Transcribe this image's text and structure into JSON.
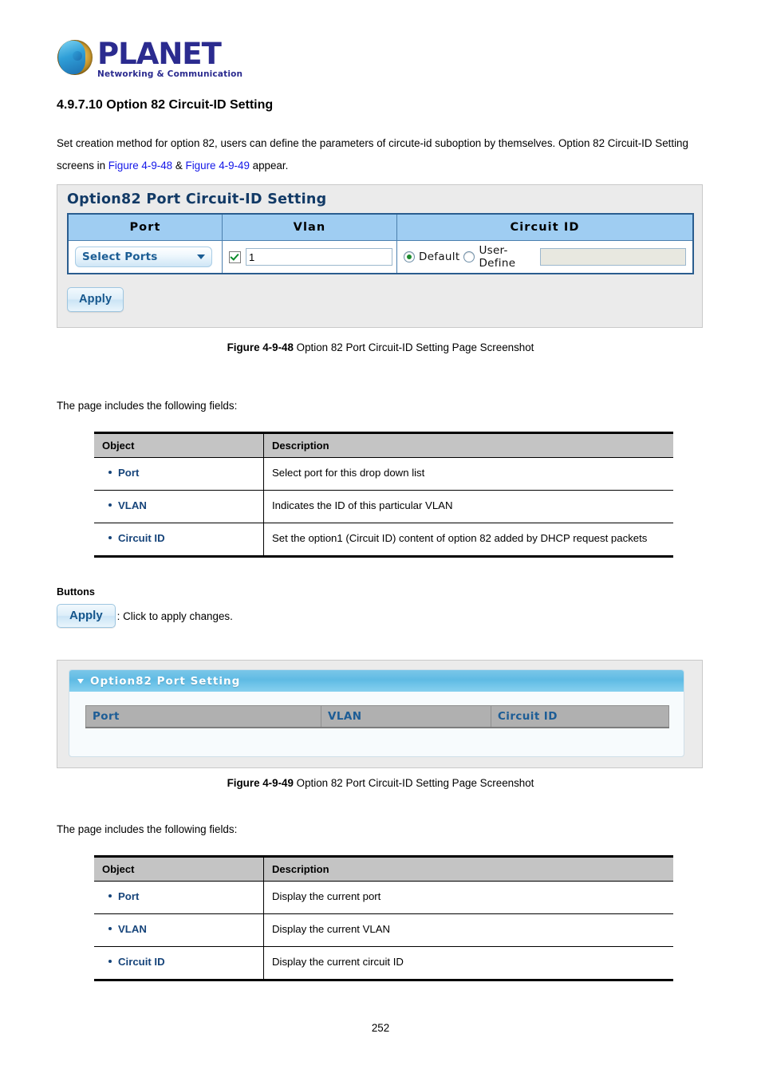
{
  "brand": {
    "name": "PLANET",
    "tagline": "Networking & Communication",
    "logo_icon": "globe-icon"
  },
  "document": {
    "section_number": "4.9.7.10",
    "section_title": "4.9.7.10 Option 82 Circuit-ID Setting",
    "intro_part1": "Set creation method for option 82, users can define the parameters of circute-id suboption by themselves. Option 82 Circuit-ID Setting screens in ",
    "intro_link1": "Figure 4-9-48",
    "intro_amp": " & ",
    "intro_link2": "Figure 4-9-49",
    "intro_part2": " appear.",
    "fields_note": "The page includes the following fields:",
    "buttons_heading": "Buttons",
    "apply_legend": ": Click to apply changes.",
    "page_number": "252"
  },
  "figure_captions": {
    "fig1_label": "Figure 4-9-48",
    "fig1_text": " Option 82 Port Circuit-ID Setting Page Screenshot",
    "fig2_label": "Figure 4-9-49",
    "fig2_text": " Option 82 Port Circuit-ID Setting Page Screenshot"
  },
  "screenshot1": {
    "title": "Option82 Port Circuit-ID Setting",
    "headers": {
      "port": "Port",
      "vlan": "Vlan",
      "circuit_id": "Circuit ID"
    },
    "port_select": {
      "value": "Select Ports",
      "icon": "chevron-down-icon"
    },
    "vlan": {
      "checkbox_checked": true,
      "value": "1",
      "placeholder": ""
    },
    "circuit_id": {
      "radio_default_label": "Default",
      "radio_userdefine_label": "User-Define",
      "selected": "Default",
      "userdefine_value": "",
      "userdefine_placeholder": ""
    },
    "apply_label": "Apply"
  },
  "screenshot2": {
    "panel_title": "Option82 Port Setting",
    "collapse_icon": "caret-down-icon",
    "columns": [
      "Port",
      "VLAN",
      "Circuit ID"
    ],
    "rows": []
  },
  "fields_table_1": {
    "headers": [
      "Object",
      "Description"
    ],
    "rows": [
      {
        "object": "Port",
        "description": "Select port for this drop down list"
      },
      {
        "object": "VLAN",
        "description": "Indicates the ID of this particular VLAN"
      },
      {
        "object": "Circuit ID",
        "description": "Set the option1 (Circuit ID) content of option 82 added by DHCP request packets"
      }
    ]
  },
  "fields_table_2": {
    "headers": [
      "Object",
      "Description"
    ],
    "rows": [
      {
        "object": "Port",
        "description": "Display the current port"
      },
      {
        "object": "VLAN",
        "description": "Display the current VLAN"
      },
      {
        "object": "Circuit ID",
        "description": "Display the current circuit ID"
      }
    ]
  },
  "buttons": {
    "apply_label": "Apply"
  },
  "colors": {
    "link": "#1417e8",
    "object_blue": "#16447a",
    "header_blue": "#9fcdf2",
    "panel_blue": "#5fbbe4",
    "table_gray": "#c4c4c4"
  }
}
